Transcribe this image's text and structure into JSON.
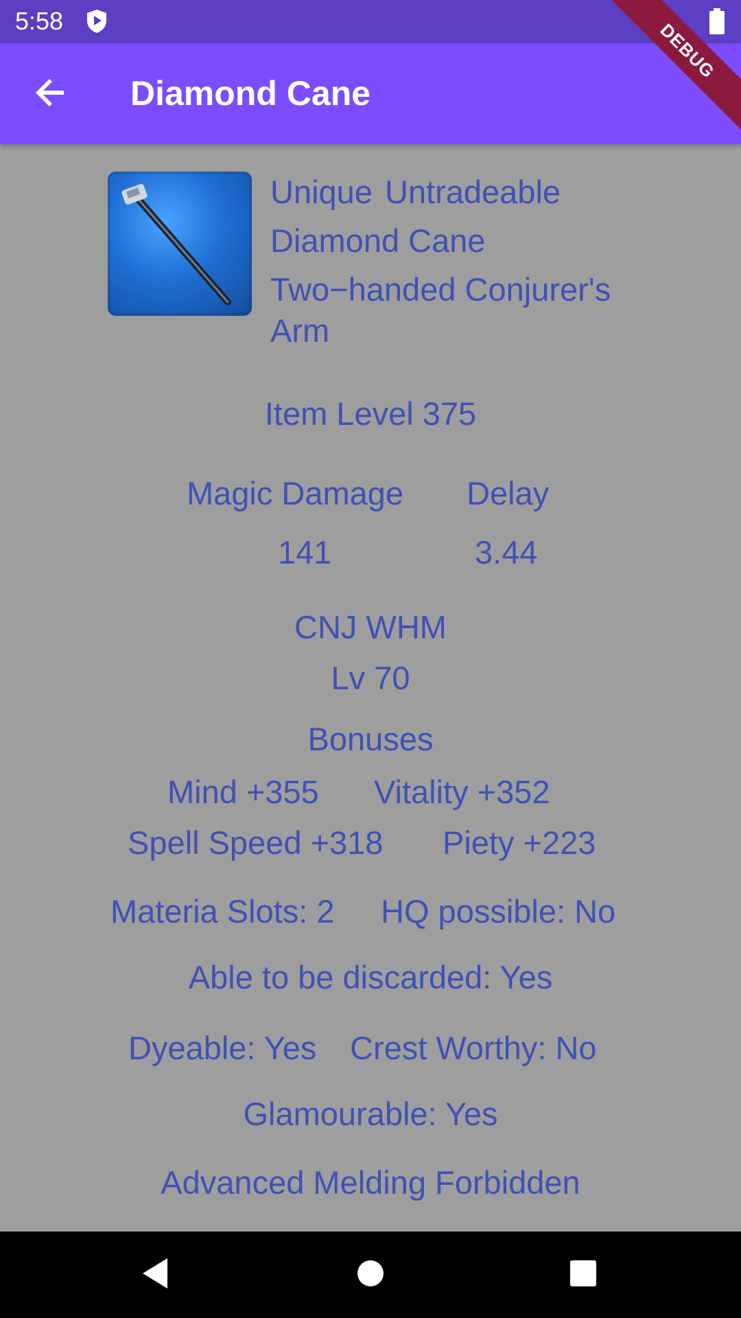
{
  "status_bar": {
    "time": "5:58"
  },
  "debug_banner": "DEBUG",
  "app_bar": {
    "title": "Diamond Cane"
  },
  "item": {
    "flags": [
      "Unique",
      "Untradeable"
    ],
    "name": "Diamond Cane",
    "category_line1": "Two−handed Conjurer's",
    "category_line2": "Arm",
    "item_level": "Item Level 375",
    "stats": {
      "magic_damage_label": "Magic Damage",
      "magic_damage_value": "141",
      "delay_label": "Delay",
      "delay_value": "3.44"
    },
    "jobs": "CNJ WHM",
    "level": "Lv 70",
    "bonuses_title": "Bonuses",
    "bonuses": [
      [
        "Mind +355",
        "Vitality +352"
      ],
      [
        "Spell Speed +318",
        "Piety +223"
      ]
    ],
    "materia_slots": "Materia Slots: 2",
    "hq_possible": "HQ possible: No",
    "discardable": "Able to be discarded: Yes",
    "dyeable": "Dyeable: Yes",
    "crest_worthy": "Crest Worthy: No",
    "glamourable": "Glamourable: Yes",
    "advanced_melding": "Advanced Melding Forbidden"
  },
  "icons": {
    "back": "arrow-back-icon",
    "shield": "shield-icon",
    "battery": "battery-icon",
    "nav_back": "nav-back-triangle-icon",
    "nav_home": "nav-home-circle-icon",
    "nav_recents": "nav-recents-square-icon"
  },
  "colors": {
    "status_bar": "#5e3ec2",
    "app_bar": "#7c4dff",
    "background": "#9e9e9e",
    "text": "#3f51b5",
    "debug": "#8b1a3e"
  }
}
